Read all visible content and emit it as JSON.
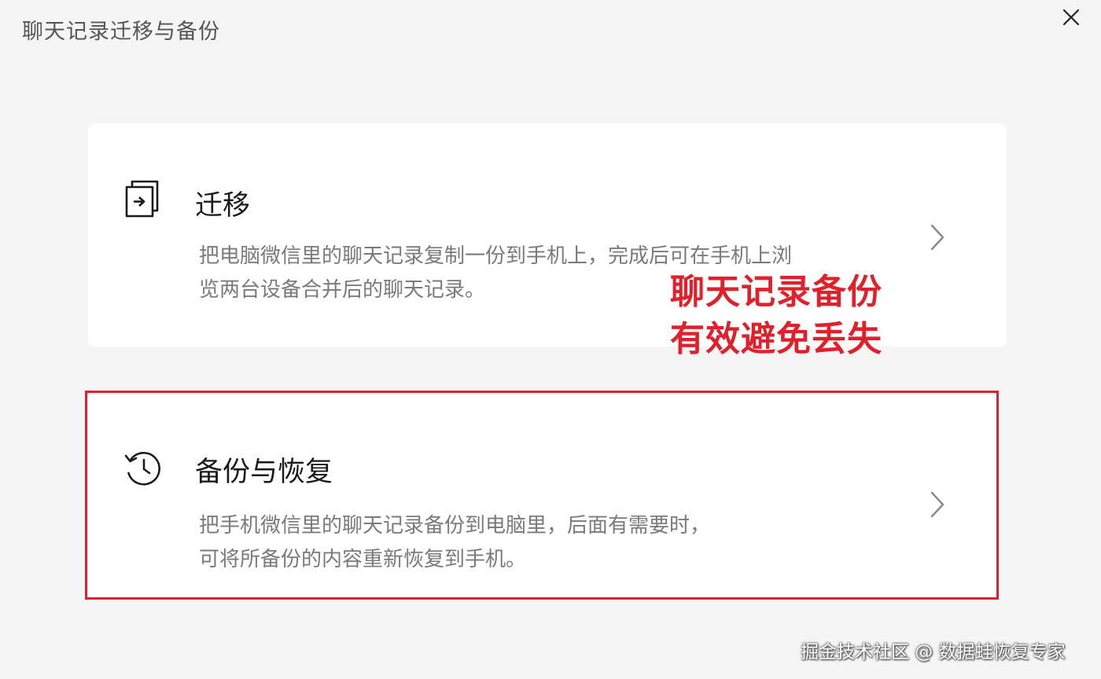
{
  "dialog": {
    "title": "聊天记录迁移与备份",
    "close_icon": "close-icon"
  },
  "options": [
    {
      "title": "迁移",
      "icon": "migrate-icon",
      "desc_line1": "把电脑微信里的聊天记录复制一份到手机上，完成后可在手机上浏",
      "desc_line2": "览两台设备合并后的聊天记录。"
    },
    {
      "title": "备份与恢复",
      "icon": "history-icon",
      "desc_line1": "把手机微信里的聊天记录备份到电脑里，后面有需要时，",
      "desc_line2": "可将所备份的内容重新恢复到手机。"
    }
  ],
  "annotation": {
    "line1": "聊天记录备份",
    "line2": "有效避免丢失",
    "color": "#e0202a"
  },
  "watermark": "掘金技术社区 @ 数据蛙恢复专家"
}
